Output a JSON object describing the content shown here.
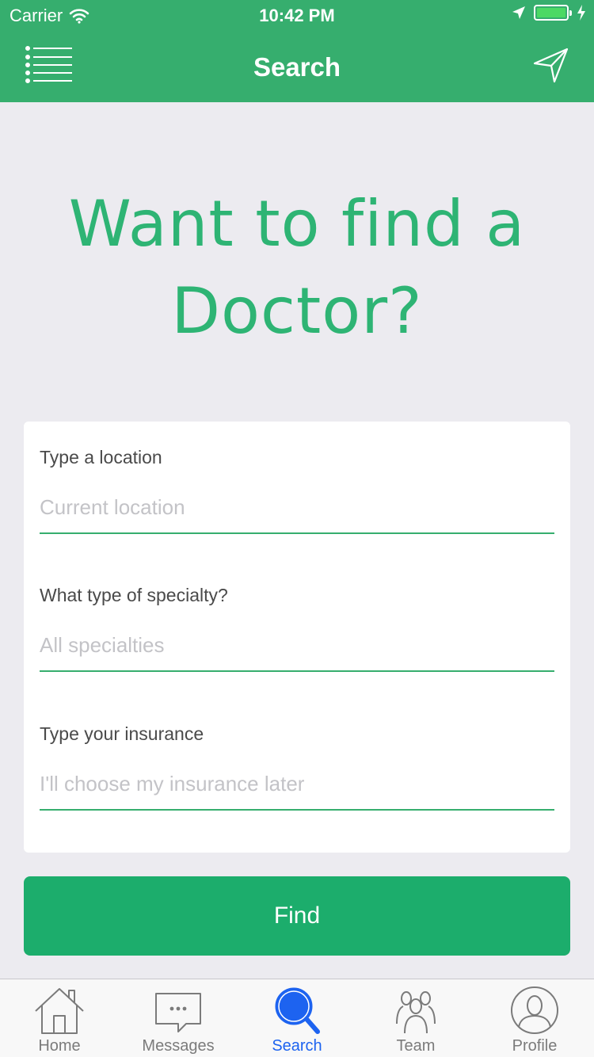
{
  "status": {
    "carrier": "Carrier",
    "time": "10:42 PM"
  },
  "nav": {
    "title": "Search"
  },
  "headline": {
    "line1": "Want to find a",
    "line2": "Doctor?"
  },
  "form": {
    "location": {
      "label": "Type a location",
      "placeholder": "Current location"
    },
    "specialty": {
      "label": "What type of specialty?",
      "placeholder": "All specialties"
    },
    "insurance": {
      "label": "Type your insurance",
      "placeholder": "I'll choose my insurance later"
    }
  },
  "find_label": "Find",
  "colors": {
    "brand": "#36ae6e",
    "accent": "#1cad6c",
    "tab_active": "#1d63f0"
  },
  "tabs": [
    {
      "label": "Home",
      "icon": "home-icon"
    },
    {
      "label": "Messages",
      "icon": "messages-icon"
    },
    {
      "label": "Search",
      "icon": "search-icon",
      "active": true
    },
    {
      "label": "Team",
      "icon": "team-icon"
    },
    {
      "label": "Profile",
      "icon": "profile-icon"
    }
  ]
}
